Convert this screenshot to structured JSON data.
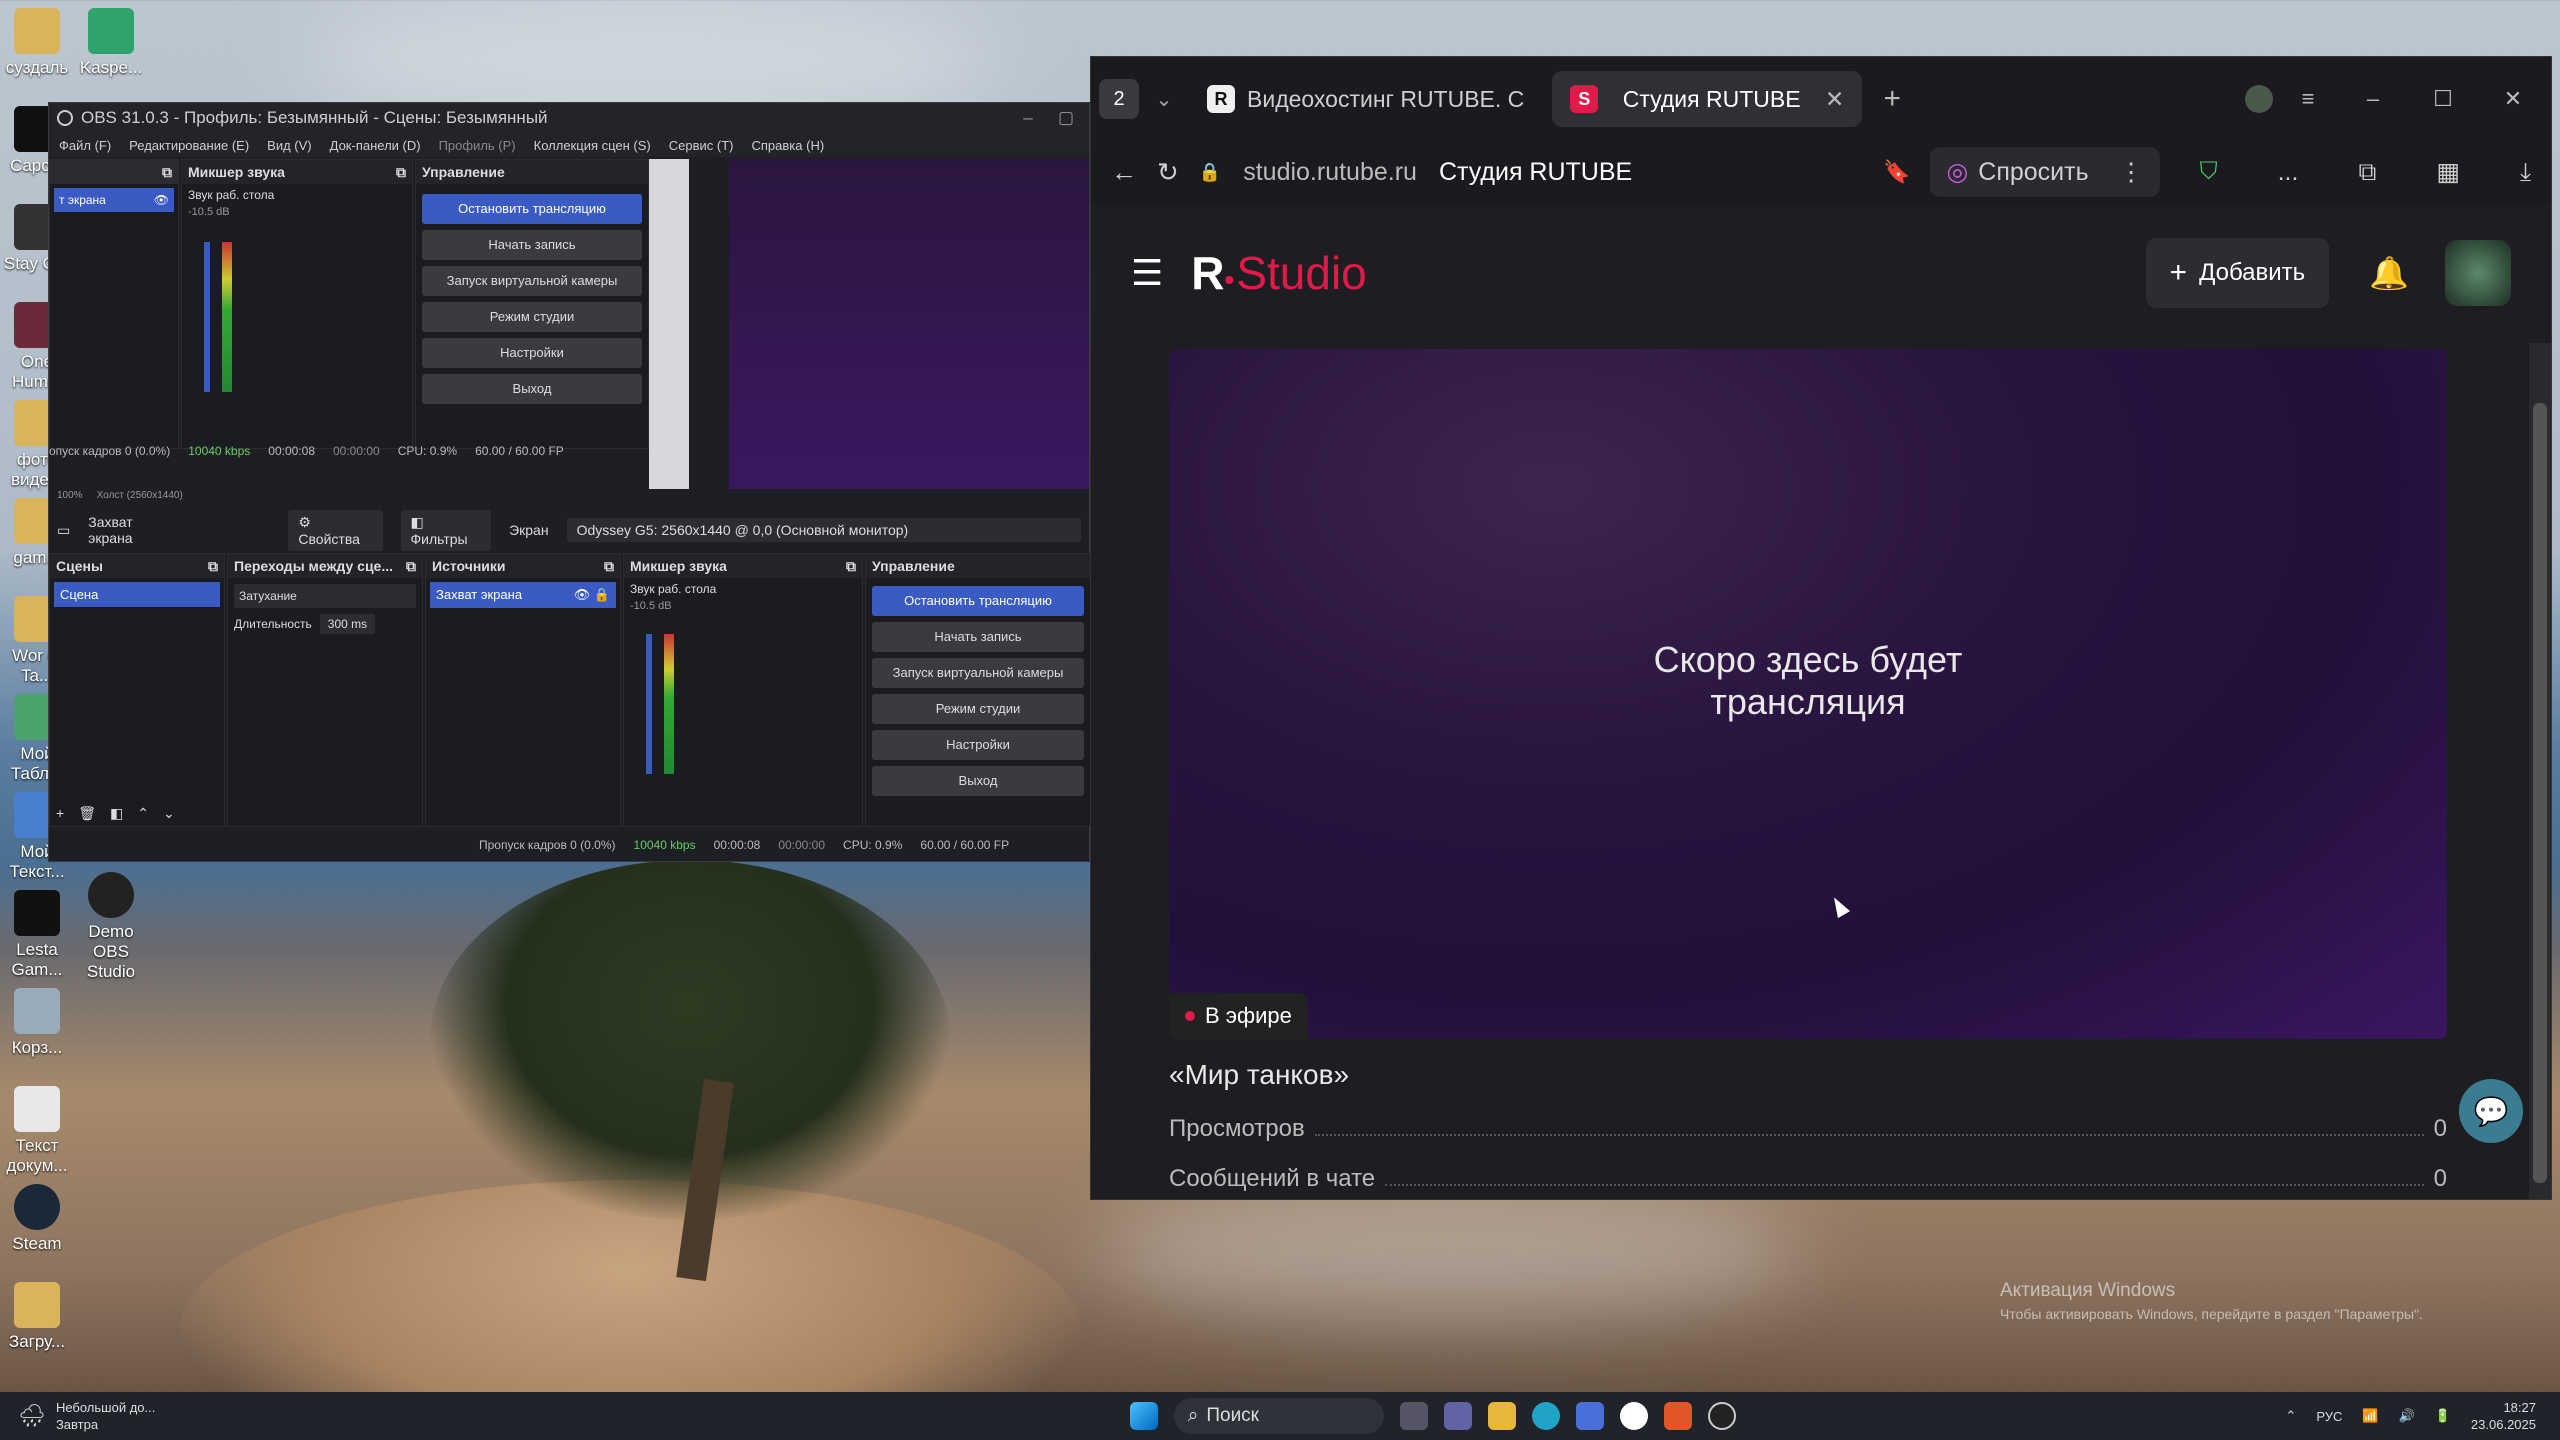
{
  "desktop": {
    "icons": [
      "суздаль",
      "Kaspe...",
      "Capcut",
      "Stay Out",
      "One Hum...",
      "фото виде...",
      "gam...",
      "Wor of Ta...",
      "Мой Табл...",
      "Мой Текст...",
      "Lesta Gam...",
      "Demo OBS Studio",
      "Корз...",
      "Текст докум...",
      "Steam",
      "Загру..."
    ],
    "activation_title": "Активация Windows",
    "activation_text": "Чтобы активировать Windows, перейдите в раздел \"Параметры\"."
  },
  "obs": {
    "title": "OBS 31.0.3 - Профиль: Безымянный - Сцены: Безымянный",
    "menu": [
      "Файл (F)",
      "Редактирование (E)",
      "Вид (V)",
      "Док-панели (D)",
      "Профиль (P)",
      "Коллекция сцен (S)",
      "Сервис (T)",
      "Справка (H)"
    ],
    "top": {
      "source_label": "т экрана",
      "mixer_title": "Микшер звука",
      "mixer_track": "Звук раб. стола",
      "mixer_db": "-10.5 dB",
      "controls_title": "Управление",
      "buttons": [
        "Остановить трансляцию",
        "Начать запись",
        "Запуск виртуальной камеры",
        "Режим студии",
        "Настройки",
        "Выход"
      ],
      "status": [
        "опуск кадров 0 (0.0%)",
        "10040 kbps",
        "00:00:08",
        "00:00:00",
        "CPU: 0.9%",
        "60.00 / 60.00 FP"
      ],
      "zoom": "100%",
      "canvas": "Холст (2560x1440)"
    },
    "toolbar": {
      "source": "Захват экрана",
      "properties": "Свойства",
      "filters": "Фильтры",
      "screen_label": "Экран",
      "screen_value": "Odyssey G5: 2560x1440 @ 0,0 (Основной монитор)"
    },
    "docks": {
      "scenes_title": "Сцены",
      "scene_item": "Сцена",
      "transitions_title": "Переходы между сце...",
      "transition_value": "Затухание",
      "duration_label": "Длительность",
      "duration_value": "300 ms",
      "sources_title": "Источники",
      "source_item": "Захват экрана",
      "mixer_title": "Микшер звука",
      "mixer_track": "Звук раб. стола",
      "mixer_db": "-10.5 dB",
      "controls_title": "Управление",
      "buttons": [
        "Остановить трансляцию",
        "Начать запись",
        "Запуск виртуальной камеры",
        "Режим студии",
        "Настройки",
        "Выход"
      ]
    },
    "status": [
      "Пропуск кадров 0 (0.0%)",
      "10040 kbps",
      "00:00:08",
      "00:00:00",
      "CPU: 0.9%",
      "60.00 / 60.00 FP"
    ]
  },
  "browser": {
    "tab_count": "2",
    "tabs": [
      "Видеохостинг RUTUBE. С",
      "Студия RUTUBE"
    ],
    "url": "studio.rutube.ru",
    "page_title": "Студия RUTUBE",
    "ask": "Спросить",
    "more": "...",
    "app": {
      "logo_r": "R",
      "logo_studio": "Studio",
      "add_button": "Добавить"
    },
    "player": {
      "message": "Скоро здесь будет трансляция",
      "live": "В эфире"
    },
    "stream_title": "«Мир танков»",
    "stats": [
      {
        "label": "Просмотров",
        "value": "0"
      },
      {
        "label": "Сообщений в чате",
        "value": "0"
      }
    ]
  },
  "taskbar": {
    "weather_title": "Небольшой до...",
    "weather_sub": "Завтра",
    "search": "Поиск",
    "lang": "РУС",
    "time": "18:27",
    "date": "23.06.2025"
  }
}
